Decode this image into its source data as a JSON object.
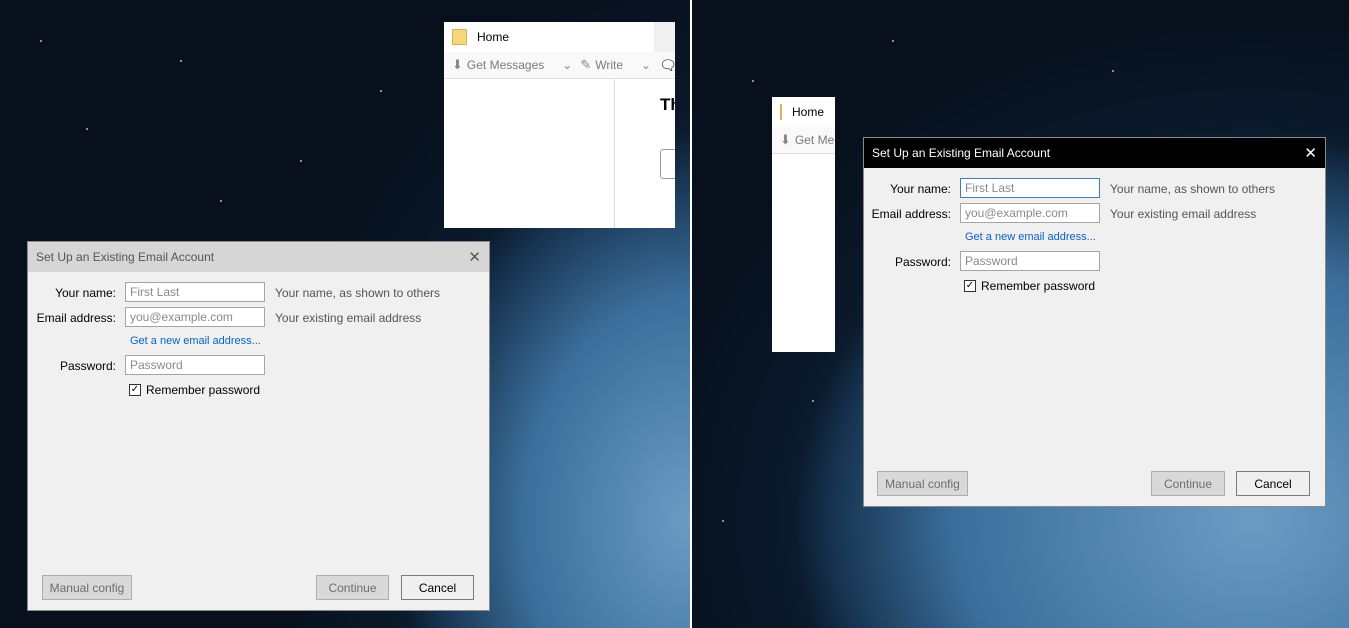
{
  "thunderbird": {
    "home_tab": "Home",
    "get_messages": "Get Messages",
    "write": "Write",
    "partial_heading": "Th",
    "partial_tab": "Home",
    "partial_get_messages": "Get Me"
  },
  "dialog": {
    "title": "Set Up an Existing Email Account",
    "name_label": "Your name:",
    "name_placeholder": "First Last",
    "name_hint": "Your name, as shown to others",
    "email_label": "Email address:",
    "email_placeholder": "you@example.com",
    "email_hint": "Your existing email address",
    "new_email_link": "Get a new email address...",
    "password_label": "Password:",
    "password_placeholder": "Password",
    "remember_label": "Remember password",
    "remember_checked": true,
    "manual_config": "Manual config",
    "continue": "Continue",
    "cancel": "Cancel",
    "close_glyph": "✕",
    "check_glyph": "✓"
  },
  "colors": {
    "link": "#0b62c4",
    "active_titlebar": "#000000",
    "inactive_titlebar": "#d6d6d6"
  }
}
